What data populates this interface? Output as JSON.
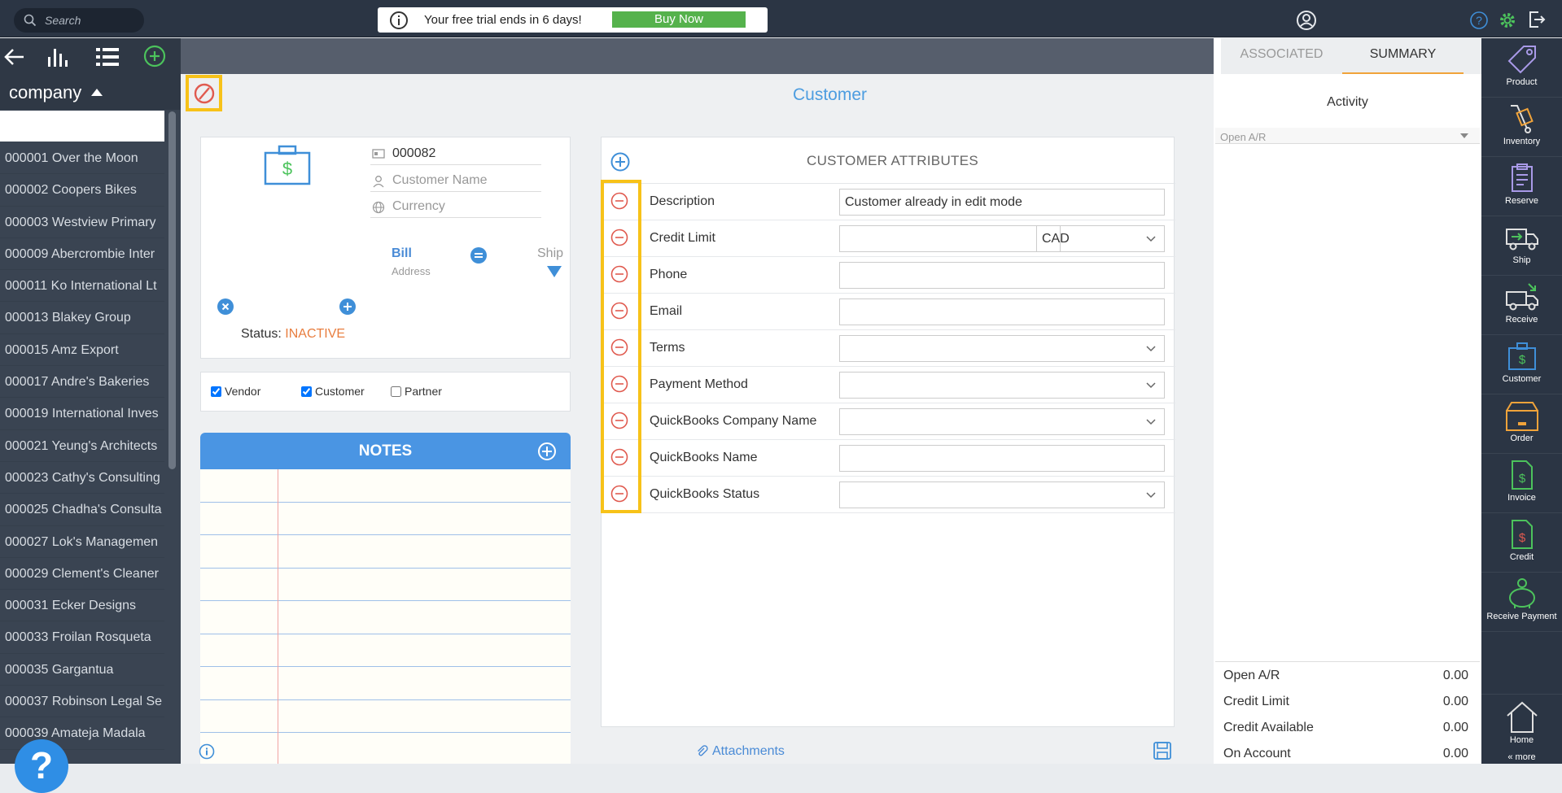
{
  "topbar": {
    "search_placeholder": "Search",
    "trial_message": "Your free trial ends in 6 days!",
    "buy_now_label": "Buy Now"
  },
  "leftnav": {
    "company_label": "company",
    "items": [
      "000001 Over the Moon",
      "000002 Coopers Bikes",
      "000003 Westview Primary",
      "000009 Abercrombie Inter",
      "000011 Ko International Lt",
      "000013 Blakey Group",
      "000015 Amz Export",
      "000017 Andre's Bakeries",
      "000019 International Inves",
      "000021 Yeung's Architects",
      "000023 Cathy's Consulting",
      "000025 Chadha's Consulta",
      "000027 Lok's Managemen",
      "000029 Clement's Cleaner",
      "000031 Ecker Designs",
      "000033 Froilan Rosqueta",
      "000035 Gargantua",
      "000037 Robinson Legal Se",
      "000039 Amateja Madala"
    ]
  },
  "main": {
    "title": "Customer",
    "customer_number": "000082",
    "customer_name_placeholder": "Customer Name",
    "currency_placeholder": "Currency",
    "bill_label": "Bill",
    "address_label": "Address",
    "ship_label": "Ship",
    "status_label": "Status:",
    "status_value": "INACTIVE",
    "checkboxes": {
      "vendor": "Vendor",
      "customer": "Customer",
      "partner": "Partner"
    },
    "notes_title": "NOTES",
    "attachments_label": "Attachments"
  },
  "attributes": {
    "title": "CUSTOMER ATTRIBUTES",
    "rows": [
      {
        "label": "Description",
        "value": "Customer already in edit mode"
      },
      {
        "label": "Credit Limit",
        "value": "",
        "currency": "CAD"
      },
      {
        "label": "Phone",
        "value": ""
      },
      {
        "label": "Email",
        "value": ""
      },
      {
        "label": "Terms",
        "value": ""
      },
      {
        "label": "Payment Method",
        "value": ""
      },
      {
        "label": "QuickBooks Company Name",
        "value": ""
      },
      {
        "label": "QuickBooks Name",
        "value": ""
      },
      {
        "label": "QuickBooks Status",
        "value": ""
      }
    ]
  },
  "rightpanel": {
    "tab_associated": "ASSOCIATED",
    "tab_summary": "SUMMARY",
    "activity_label": "Activity",
    "open_ar_dropdown": "Open A/R",
    "summary": [
      {
        "label": "Open A/R",
        "value": "0.00"
      },
      {
        "label": "Credit Limit",
        "value": "0.00"
      },
      {
        "label": "Credit Available",
        "value": "0.00"
      },
      {
        "label": "On Account",
        "value": "0.00"
      }
    ]
  },
  "rail": {
    "items": [
      "Product",
      "Inventory",
      "Reserve",
      "Ship",
      "Receive",
      "Customer",
      "Order",
      "Invoice",
      "Credit",
      "Receive Payment"
    ],
    "home_label": "Home",
    "more_label": "« more"
  },
  "colors": {
    "accent_blue": "#4d9de0",
    "highlight_yellow": "#f7c219",
    "remove_red": "#e05a4f",
    "buy_green": "#55b24c",
    "inactive_orange": "#e87d3e"
  }
}
